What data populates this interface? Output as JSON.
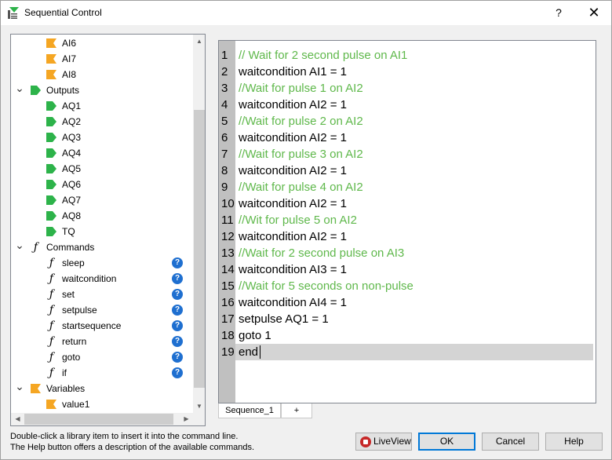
{
  "window": {
    "title": "Sequential Control",
    "help_glyph": "?",
    "close_glyph": "✕"
  },
  "colors": {
    "output_green": "#2db34a",
    "input_orange": "#f5a623",
    "help_blue": "#1e6fd0",
    "comment_green": "#5fb84b"
  },
  "tree": {
    "items": [
      {
        "kind": "leaf",
        "icon": "input-flag-icon",
        "label": "AI6"
      },
      {
        "kind": "leaf",
        "icon": "input-flag-icon",
        "label": "AI7"
      },
      {
        "kind": "leaf",
        "icon": "input-flag-icon",
        "label": "AI8"
      },
      {
        "kind": "group",
        "icon": "output-tag-icon",
        "label": "Outputs",
        "expanded": true
      },
      {
        "kind": "leaf",
        "icon": "output-tag-icon",
        "label": "AQ1"
      },
      {
        "kind": "leaf",
        "icon": "output-tag-icon",
        "label": "AQ2"
      },
      {
        "kind": "leaf",
        "icon": "output-tag-icon",
        "label": "AQ3"
      },
      {
        "kind": "leaf",
        "icon": "output-tag-icon",
        "label": "AQ4"
      },
      {
        "kind": "leaf",
        "icon": "output-tag-icon",
        "label": "AQ5"
      },
      {
        "kind": "leaf",
        "icon": "output-tag-icon",
        "label": "AQ6"
      },
      {
        "kind": "leaf",
        "icon": "output-tag-icon",
        "label": "AQ7"
      },
      {
        "kind": "leaf",
        "icon": "output-tag-icon",
        "label": "AQ8"
      },
      {
        "kind": "leaf",
        "icon": "output-tag-icon",
        "label": "TQ"
      },
      {
        "kind": "group",
        "icon": "function-icon",
        "label": "Commands",
        "expanded": true
      },
      {
        "kind": "leaf",
        "icon": "function-icon",
        "label": "sleep",
        "help": true
      },
      {
        "kind": "leaf",
        "icon": "function-icon",
        "label": "waitcondition",
        "help": true
      },
      {
        "kind": "leaf",
        "icon": "function-icon",
        "label": "set",
        "help": true
      },
      {
        "kind": "leaf",
        "icon": "function-icon",
        "label": "setpulse",
        "help": true
      },
      {
        "kind": "leaf",
        "icon": "function-icon",
        "label": "startsequence",
        "help": true
      },
      {
        "kind": "leaf",
        "icon": "function-icon",
        "label": "return",
        "help": true
      },
      {
        "kind": "leaf",
        "icon": "function-icon",
        "label": "goto",
        "help": true
      },
      {
        "kind": "leaf",
        "icon": "function-icon",
        "label": "if",
        "help": true
      },
      {
        "kind": "group",
        "icon": "input-flag-icon",
        "label": "Variables",
        "expanded": true
      },
      {
        "kind": "leaf",
        "icon": "input-flag-icon",
        "label": "value1"
      }
    ]
  },
  "editor": {
    "current_line": 19,
    "lines": [
      {
        "n": "1",
        "text": "// Wait for 2 second pulse on AI1",
        "comment": true
      },
      {
        "n": "2",
        "text": "waitcondition AI1 = 1",
        "comment": false
      },
      {
        "n": "3",
        "text": "//Wait for pulse 1 on AI2",
        "comment": true
      },
      {
        "n": "4",
        "text": "waitcondition AI2 = 1",
        "comment": false
      },
      {
        "n": "5",
        "text": "//Wait for pulse 2 on AI2",
        "comment": true
      },
      {
        "n": "6",
        "text": "waitcondition AI2 = 1",
        "comment": false
      },
      {
        "n": "7",
        "text": "//Wait for pulse 3 on AI2",
        "comment": true
      },
      {
        "n": "8",
        "text": "waitcondition AI2 = 1",
        "comment": false
      },
      {
        "n": "9",
        "text": "//Wait for pulse 4 on AI2",
        "comment": true
      },
      {
        "n": "10",
        "text": "waitcondition AI2 = 1",
        "comment": false
      },
      {
        "n": "11",
        "text": "//Wit for pulse 5 on AI2",
        "comment": true
      },
      {
        "n": "12",
        "text": "waitcondition AI2 = 1",
        "comment": false
      },
      {
        "n": "13",
        "text": "//Wait for 2 second pulse on AI3",
        "comment": true
      },
      {
        "n": "14",
        "text": "waitcondition AI3 = 1",
        "comment": false
      },
      {
        "n": "15",
        "text": "//Wait for 5 seconds on non-pulse",
        "comment": true
      },
      {
        "n": "16",
        "text": "waitcondition AI4 = 1",
        "comment": false
      },
      {
        "n": "17",
        "text": "setpulse AQ1 = 1",
        "comment": false
      },
      {
        "n": "18",
        "text": "goto 1",
        "comment": false
      },
      {
        "n": "19",
        "text": "end",
        "comment": false
      }
    ]
  },
  "tabs": {
    "sequence": "Sequence_1",
    "add": "+"
  },
  "hints": {
    "line1": "Double-click a library item to insert it into the command line.",
    "line2": "The Help button offers a description of the available commands."
  },
  "buttons": {
    "liveview": "LiveView",
    "ok": "OK",
    "cancel": "Cancel",
    "help": "Help"
  }
}
